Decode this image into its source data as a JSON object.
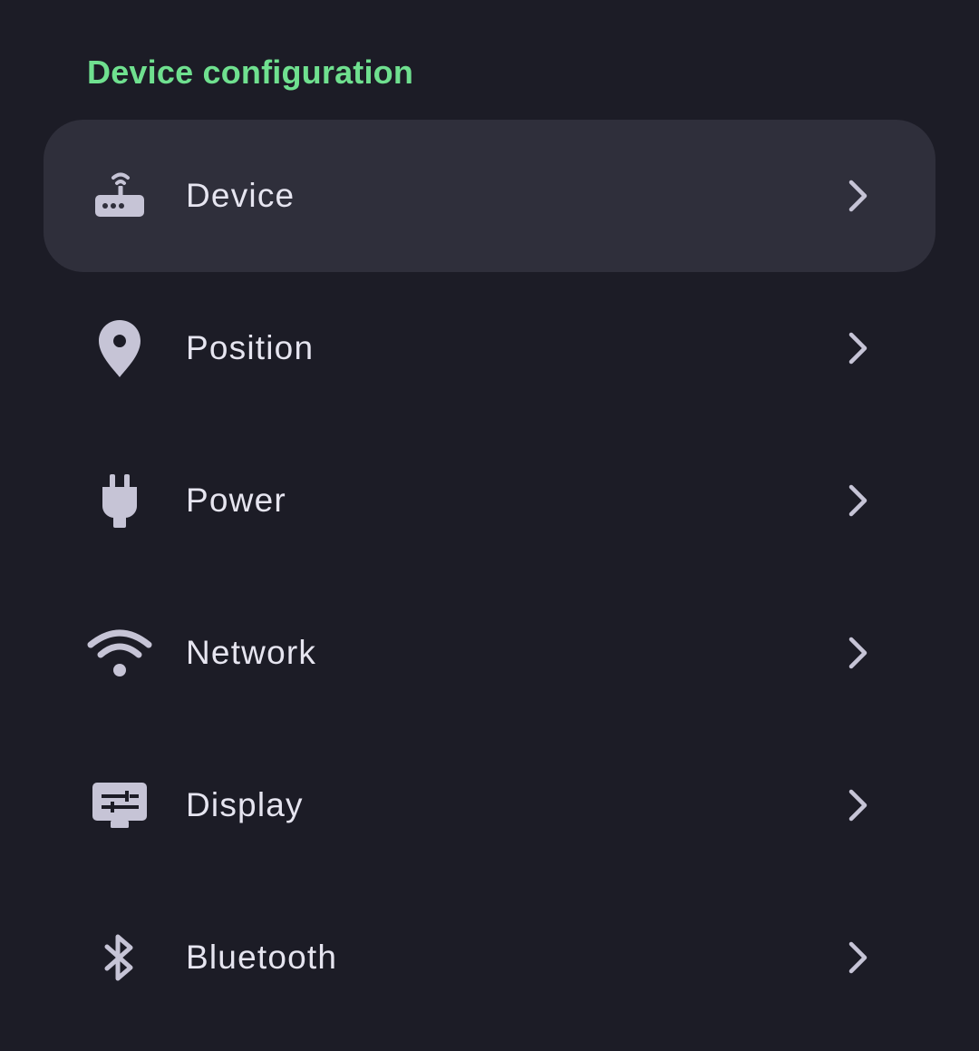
{
  "section": {
    "title": "Device configuration"
  },
  "colors": {
    "background": "#1c1c26",
    "selected_background": "#2f2f3b",
    "accent": "#6fe08f",
    "text": "#e6e5f0",
    "icon": "#c6c4d6"
  },
  "items": [
    {
      "label": "Device",
      "icon": "router-icon",
      "selected": true
    },
    {
      "label": "Position",
      "icon": "location-pin-icon",
      "selected": false
    },
    {
      "label": "Power",
      "icon": "power-plug-icon",
      "selected": false
    },
    {
      "label": "Network",
      "icon": "wifi-icon",
      "selected": false
    },
    {
      "label": "Display",
      "icon": "display-settings-icon",
      "selected": false
    },
    {
      "label": "Bluetooth",
      "icon": "bluetooth-icon",
      "selected": false
    }
  ]
}
